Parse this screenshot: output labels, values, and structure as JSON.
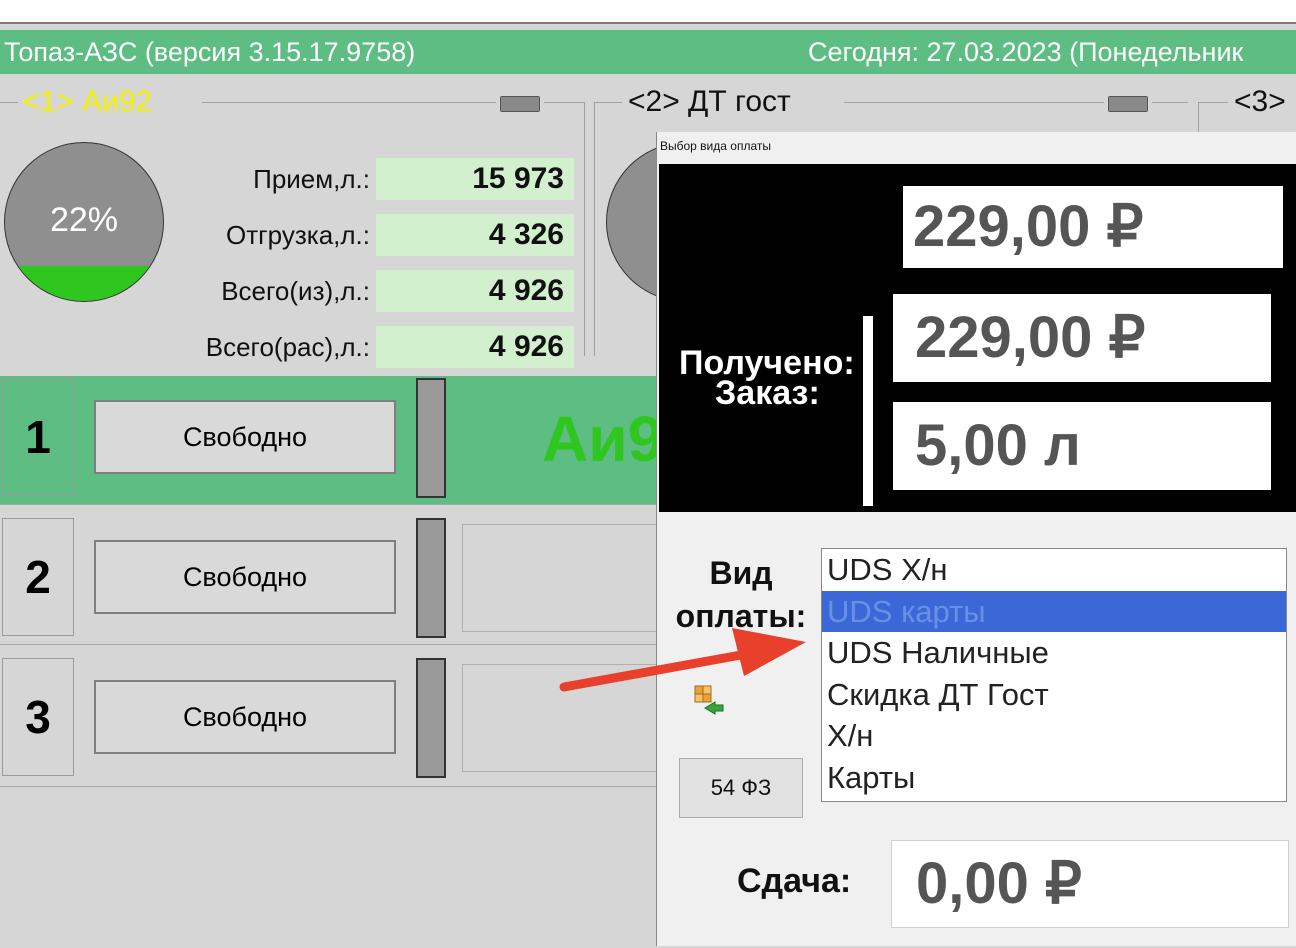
{
  "titlebar": {
    "app_title": "Топаз-АЗС  (версия 3.15.17.9758)",
    "date_text": "Сегодня: 27.03.2023  (Понедельник"
  },
  "pumps": [
    {
      "label": "<1> Аи92",
      "gauge_percent": 22,
      "gauge_text": "22%",
      "stats": [
        {
          "label": "Прием,л.:",
          "value": "15 973"
        },
        {
          "label": "Отгрузка,л.:",
          "value": "4 326"
        },
        {
          "label": "Всего(из),л.:",
          "value": "4 926"
        },
        {
          "label": "Всего(рас),л.:",
          "value": "4 926"
        }
      ]
    },
    {
      "label": "<2> ДТ гост"
    },
    {
      "label": "<3>"
    }
  ],
  "nozzles": [
    {
      "number": "1",
      "status": "Свободно",
      "fuel_overlay": "Аи9",
      "active": true
    },
    {
      "number": "2",
      "status": "Свободно",
      "active": false
    },
    {
      "number": "3",
      "status": "Свободно",
      "active": false
    }
  ],
  "colors": {
    "title_bg": "#5dbd83",
    "pump1_label": "#f5f200",
    "active_row_bg": "#5dbd83",
    "fuel_overlay": "#2ec61f",
    "selected_item": "#3b68d6",
    "arrow": "#e8402a"
  },
  "dialog": {
    "title": "Выбор вида оплаты",
    "received_label": "Получено:",
    "received_value": "229,00 ₽",
    "order_label": "Заказ:",
    "order_amount": "229,00 ₽",
    "order_volume": "5,00 л",
    "payment_type_label": "Вид оплаты:",
    "payment_types": [
      "UDS Х/н",
      "UDS карты",
      "UDS Наличные",
      "Скидка ДТ Гост",
      "Х/н",
      "Карты"
    ],
    "selected_payment_type": "UDS карты",
    "fz54_button": "54 ФЗ",
    "change_label": "Сдача:",
    "change_value": "0,00 ₽",
    "icon": "payment-swap-icon"
  }
}
